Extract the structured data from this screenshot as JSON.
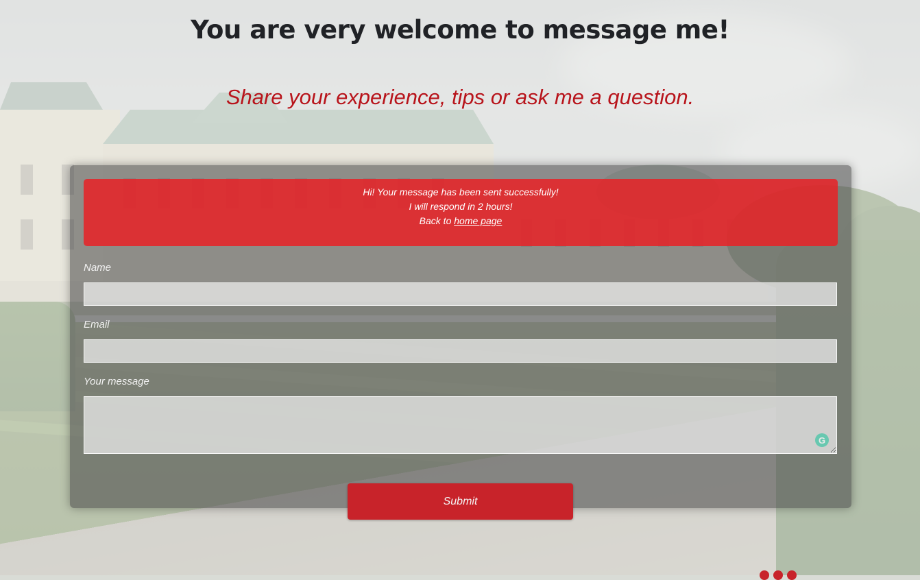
{
  "heading": {
    "title": "You are very welcome to message me!",
    "subtitle": "Share your experience, tips or ask me a question."
  },
  "alert": {
    "line1": "Hi! Your message has been sent successfully!",
    "line2": "I will respond in 2 hours!",
    "line3_prefix": "Back to ",
    "link_text": "home page"
  },
  "form": {
    "name_label": "Name",
    "name_value": "",
    "email_label": "Email",
    "email_value": "",
    "message_label": "Your message",
    "message_value": "",
    "submit_label": "Submit"
  },
  "footer": {
    "social_icons": [
      "pinterest-icon",
      "twitter-icon",
      "instagram-icon"
    ]
  },
  "colors": {
    "accent_red": "#c8232a",
    "alert_red": "#e82226",
    "title_text": "#202226",
    "subtitle_red": "#b8141b"
  }
}
